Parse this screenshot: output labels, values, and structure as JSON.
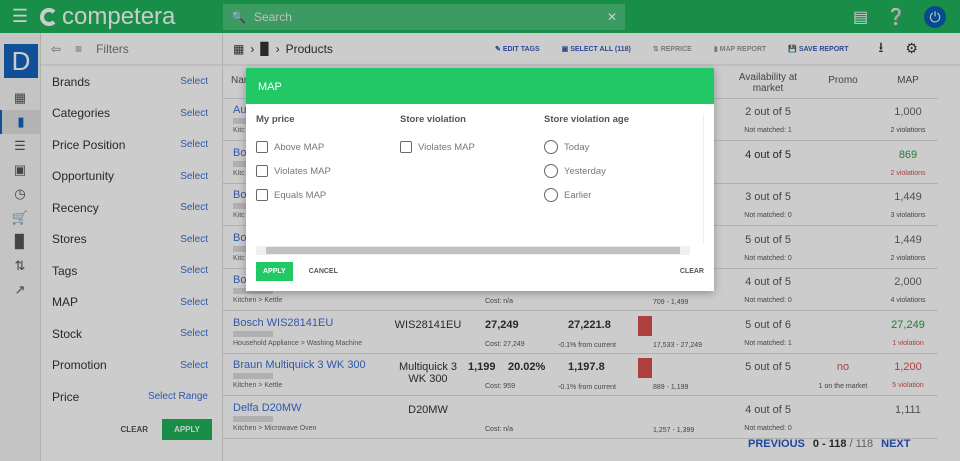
{
  "header": {
    "logo": "competera",
    "search_placeholder": "Search"
  },
  "rail": {
    "avatar": "D"
  },
  "filters": {
    "title": "Filters",
    "items": [
      {
        "label": "Brands",
        "action": "Select"
      },
      {
        "label": "Categories",
        "action": "Select"
      },
      {
        "label": "Price Position",
        "action": "Select"
      },
      {
        "label": "Opportunity",
        "action": "Select"
      },
      {
        "label": "Recency",
        "action": "Select"
      },
      {
        "label": "Stores",
        "action": "Select"
      },
      {
        "label": "Tags",
        "action": "Select"
      },
      {
        "label": "MAP",
        "action": "Select"
      },
      {
        "label": "Stock",
        "action": "Select"
      },
      {
        "label": "Promotion",
        "action": "Select"
      },
      {
        "label": "Price",
        "action": "Select Range"
      }
    ],
    "clear": "CLEAR",
    "apply": "APPLY"
  },
  "toolbar": {
    "breadcrumb": "Products",
    "edit_tags": "EDIT TAGS",
    "select_all": "SELECT ALL (118)",
    "reprice": "REPRICE",
    "map_report": "MAP REPORT",
    "save_report": "SAVE REPORT"
  },
  "table": {
    "headers": {
      "name": "Nam",
      "availability": "Availability at market",
      "promo": "Promo",
      "map": "MAP"
    },
    "rows": [
      {
        "name": "Au",
        "category": "Kitc",
        "availability": "2 out of 5",
        "avail_sub": "Not matched: 1",
        "map": "1,000",
        "map_sub": "2 violations"
      },
      {
        "name": "Bo",
        "category": "Kitc",
        "availability": "4 out of 5",
        "avail_sub": "",
        "map": "869",
        "map_sub": "2 violations"
      },
      {
        "name": "Bo",
        "category": "Kitc",
        "availability": "3 out of 5",
        "avail_sub": "Not matched: 0",
        "map": "1,449",
        "map_sub": "3 violations"
      },
      {
        "name": "Bo",
        "category": "Kitc",
        "availability": "5 out of 5",
        "avail_sub": "Not matched: 0",
        "map": "1,449",
        "map_sub": "2 violations"
      },
      {
        "name": "Bo",
        "category": "Kitchen > Kettle",
        "cost": "Cost: n/a",
        "range": "709 - 1,499",
        "availability": "4 out of 5",
        "avail_sub": "Not matched: 0",
        "map": "2,000",
        "map_sub": "4 violations"
      },
      {
        "name": "Bosch WIS28141EU",
        "model": "WIS28141EU",
        "category": "Household Appliance > Washing Machine",
        "price": "27,249",
        "cost": "Cost: 27,249",
        "rec": "27,221.8",
        "rec_sub": "-0.1% from current",
        "range": "17,533 - 27,249",
        "availability": "5 out of 6",
        "avail_sub": "Not matched: 1",
        "map": "27,249",
        "map_sub": "1 violation"
      },
      {
        "name": "Braun Multiquick 3 WK 300",
        "model": "Multiquick 3 WK 300",
        "category": "Kitchen > Kettle",
        "price": "1,199",
        "margin": "20.02%",
        "cost": "Cost: 959",
        "rec": "1,197.8",
        "rec_sub": "-0.1% from current",
        "range": "889 - 1,199",
        "availability": "5 out of 5",
        "avail_sub": "",
        "promo": "no",
        "promo_sub": "1 on the market",
        "map": "1,200",
        "map_sub": "5 violation"
      },
      {
        "name": "Delfa D20MW",
        "model": "D20MW",
        "category": "Kitchen > Microwave Oven",
        "cost": "Cost: n/a",
        "range": "1,257 - 1,399",
        "availability": "4 out of 5",
        "avail_sub": "Not matched: 0",
        "map": "1,111",
        "map_sub": ""
      }
    ]
  },
  "pagination": {
    "previous": "PREVIOUS",
    "range": "0 - 118",
    "total": "/ 118",
    "next": "NEXT"
  },
  "modal": {
    "title": "MAP",
    "my_price": {
      "title": "My price",
      "options": [
        "Above MAP",
        "Violates MAP",
        "Equals MAP"
      ]
    },
    "store_violation": {
      "title": "Store violation",
      "options": [
        "Violates MAP"
      ]
    },
    "violation_age": {
      "title": "Store violation age",
      "options": [
        "Today",
        "Yesterday",
        "Earlier"
      ]
    },
    "apply": "APPLY",
    "cancel": "CANCEL",
    "clear": "CLEAR"
  },
  "colors": {
    "brand_green": "#1fb25c",
    "modal_green": "#22c866",
    "link_blue": "#3b6fd4",
    "violation_red": "#d94f4f",
    "ok_green": "#2e9e3e"
  }
}
